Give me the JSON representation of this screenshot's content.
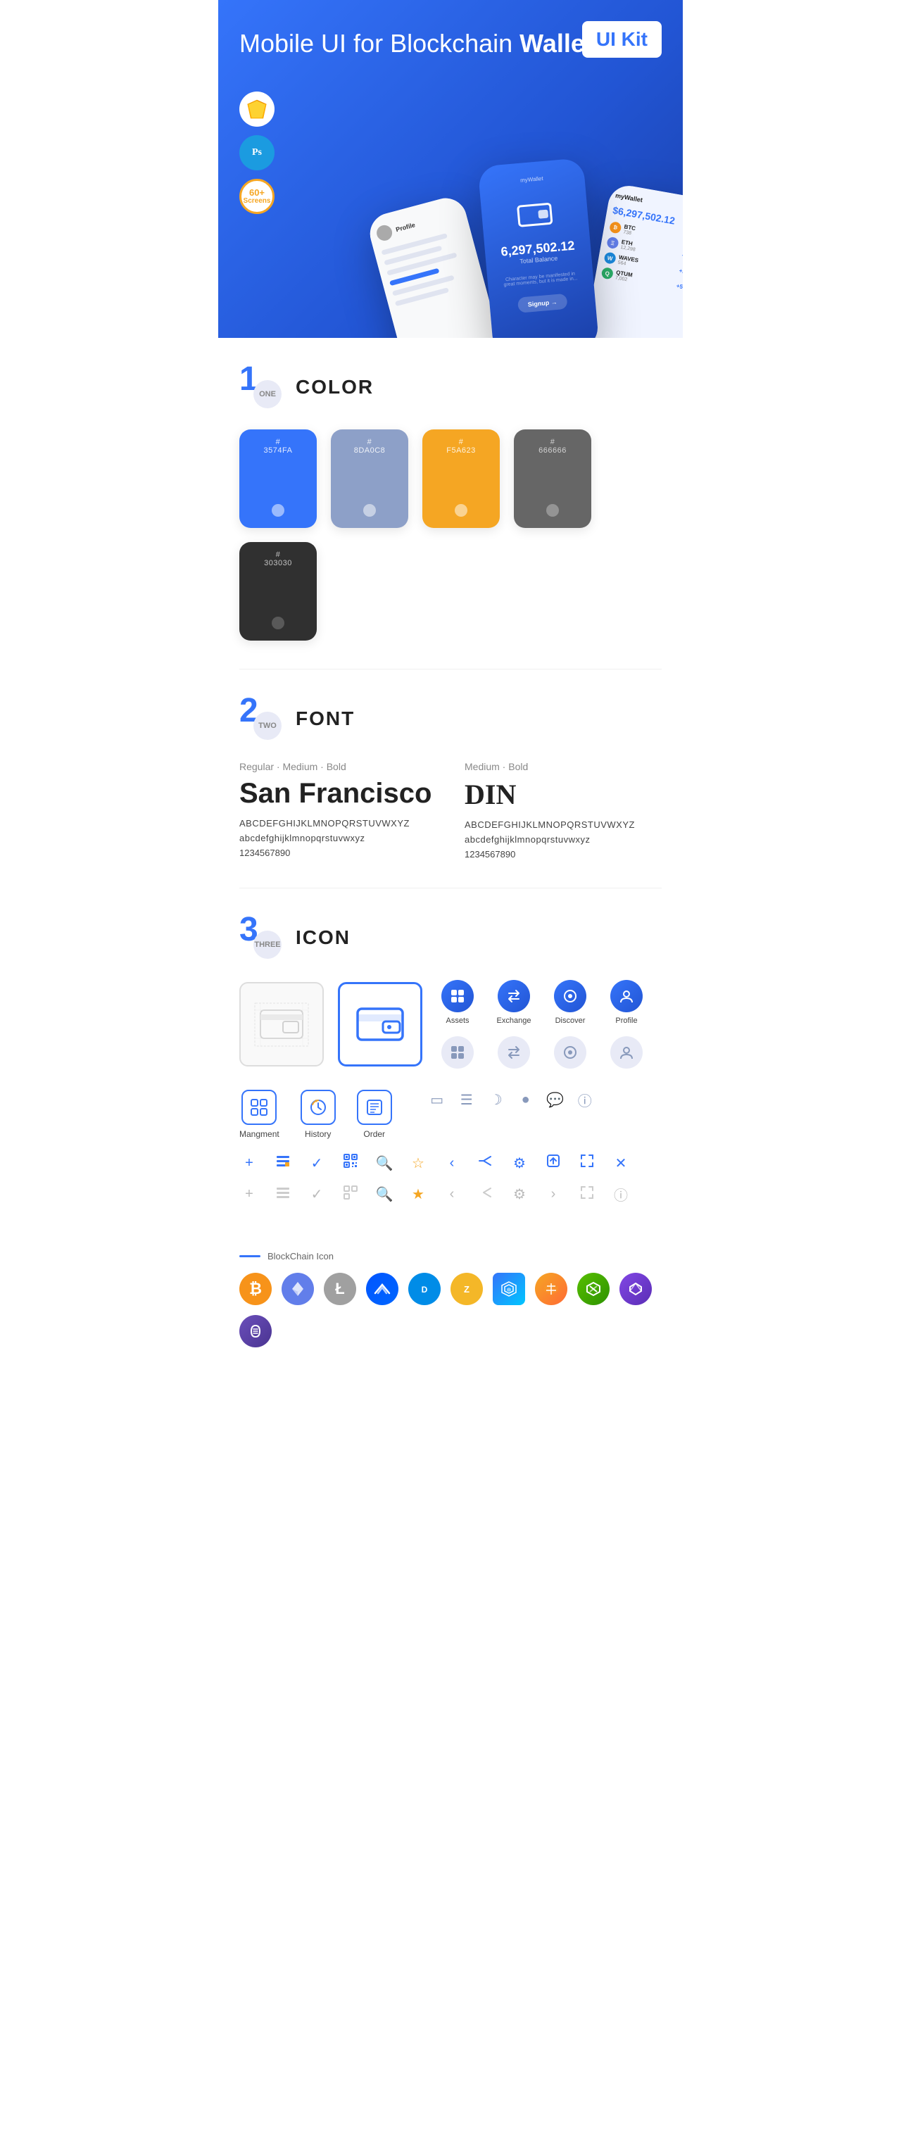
{
  "hero": {
    "title_regular": "Mobile UI for Blockchain ",
    "title_bold": "Wallet",
    "badge": "UI Kit",
    "sketch_label": "Sk",
    "ps_label": "Ps",
    "screens_count": "60+",
    "screens_label": "Screens"
  },
  "sections": {
    "color": {
      "number": "1",
      "sublabel": "ONE",
      "title": "COLOR",
      "swatches": [
        {
          "hex": "#3574FA",
          "code": "#\n3574FA",
          "light": true
        },
        {
          "hex": "#8DA0C8",
          "code": "#\n8DA0C8",
          "light": true
        },
        {
          "hex": "#F5A623",
          "code": "#\nF5A623",
          "light": true
        },
        {
          "hex": "#666666",
          "code": "#\n666666",
          "light": false
        },
        {
          "hex": "#303030",
          "code": "#\n303030",
          "light": true
        }
      ]
    },
    "font": {
      "number": "2",
      "sublabel": "TWO",
      "title": "FONT",
      "fonts": [
        {
          "style_label": "Regular · Medium · Bold",
          "name": "San Francisco",
          "upper": "ABCDEFGHIJKLMNOPQRSTUVWXYZ",
          "lower": "abcdefghijklmnopqrstuvwxyz",
          "numbers": "1234567890"
        },
        {
          "style_label": "Medium · Bold",
          "name": "DIN",
          "upper": "ABCDEFGHIJKLMNOPQRSTUVWXYZ",
          "lower": "abcdefghijklmnopqrstuvwxyz",
          "numbers": "1234567890"
        }
      ]
    },
    "icon": {
      "number": "3",
      "sublabel": "THREE",
      "title": "ICON",
      "nav_icons": [
        {
          "label": "Assets",
          "filled": true
        },
        {
          "label": "Exchange",
          "filled": true
        },
        {
          "label": "Discover",
          "filled": true
        },
        {
          "label": "Profile",
          "filled": true
        }
      ],
      "mgmt_icons": [
        {
          "label": "Mangment"
        },
        {
          "label": "History"
        },
        {
          "label": "Order"
        }
      ]
    },
    "blockchain": {
      "label": "BlockChain Icon",
      "coins": [
        "BTC",
        "ETH",
        "LTC",
        "WAVES",
        "DASH",
        "ZEC",
        "GRID",
        "ARK",
        "NEO",
        "MATIC",
        "XRP"
      ]
    }
  }
}
